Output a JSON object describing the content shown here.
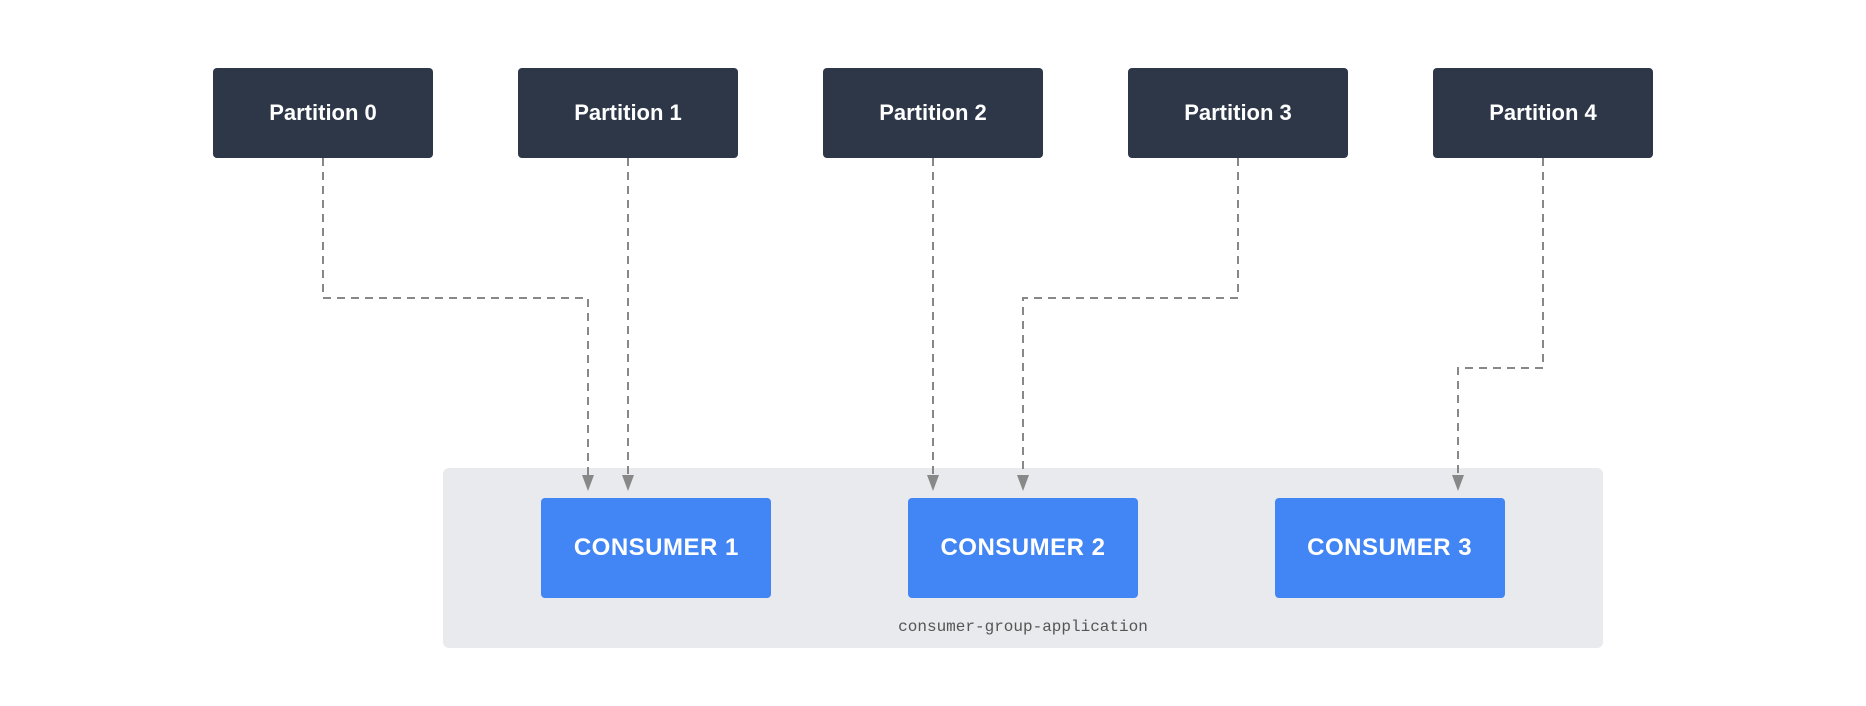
{
  "partitions": [
    {
      "label": "Partition 0"
    },
    {
      "label": "Partition 1"
    },
    {
      "label": "Partition 2"
    },
    {
      "label": "Partition 3"
    },
    {
      "label": "Partition 4"
    }
  ],
  "consumers": [
    {
      "label": "CONSUMER 1"
    },
    {
      "label": "CONSUMER 2"
    },
    {
      "label": "CONSUMER 3"
    }
  ],
  "group_label": "consumer-group-application"
}
